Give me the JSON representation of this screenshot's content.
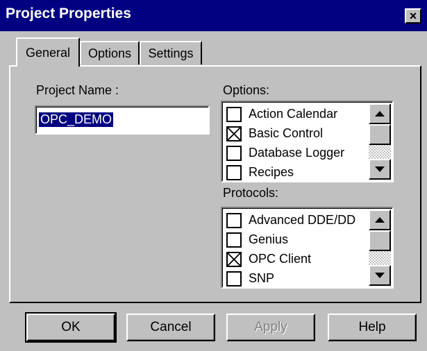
{
  "window": {
    "title": "Project Properties",
    "close_glyph": "×"
  },
  "tabs": [
    {
      "label": "General",
      "active": true
    },
    {
      "label": "Options",
      "active": false
    },
    {
      "label": "Settings",
      "active": false
    }
  ],
  "general": {
    "project_name_label": "Project Name :",
    "project_name_value": "OPC_DEMO",
    "options_label": "Options:",
    "options_items": [
      {
        "label": "Action Calendar",
        "checked": false
      },
      {
        "label": "Basic Control",
        "checked": true
      },
      {
        "label": "Database Logger",
        "checked": false
      },
      {
        "label": "Recipes",
        "checked": false
      }
    ],
    "protocols_label": "Protocols:",
    "protocols_items": [
      {
        "label": "Advanced DDE/DD",
        "checked": false
      },
      {
        "label": "Genius",
        "checked": false
      },
      {
        "label": "OPC Client",
        "checked": true
      },
      {
        "label": "SNP",
        "checked": false
      }
    ]
  },
  "buttons": {
    "ok": "OK",
    "cancel": "Cancel",
    "apply": "Apply",
    "help": "Help"
  },
  "colors": {
    "titlebar": "#000080",
    "face": "#c0c0c0",
    "selection": "#000080"
  }
}
